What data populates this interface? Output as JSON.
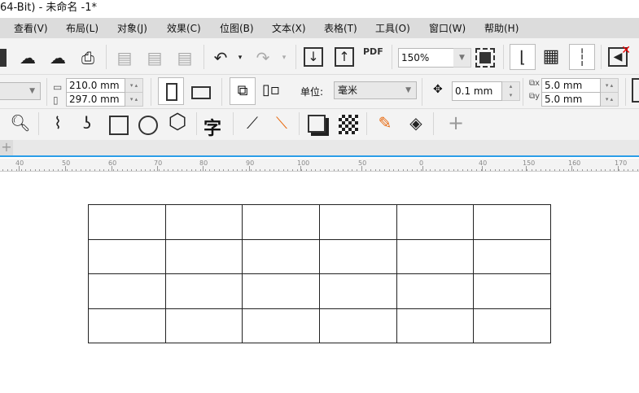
{
  "title": "64-Bit) - 未命名 -1*",
  "menu": [
    "查看(V)",
    "布局(L)",
    "对象(J)",
    "效果(C)",
    "位图(B)",
    "文本(X)",
    "表格(T)",
    "工具(O)",
    "窗口(W)",
    "帮助(H)"
  ],
  "toolbar": {
    "zoom": "150%",
    "pdf_label": "PDF"
  },
  "property_bar": {
    "width": "210.0 mm",
    "height": "297.0 mm",
    "unit_label": "单位:",
    "unit": "毫米",
    "nudge": "0.1 mm",
    "dup_x": "5.0 mm",
    "dup_y": "5.0 mm"
  },
  "toolbox": {
    "text_tool": "字"
  },
  "ruler": {
    "labels": [
      "40",
      "50",
      "60",
      "70",
      "80",
      "90",
      "100",
      "50",
      "0",
      "40",
      "150",
      "160",
      "170"
    ]
  },
  "table": {
    "rows": 4,
    "cols": 6
  }
}
